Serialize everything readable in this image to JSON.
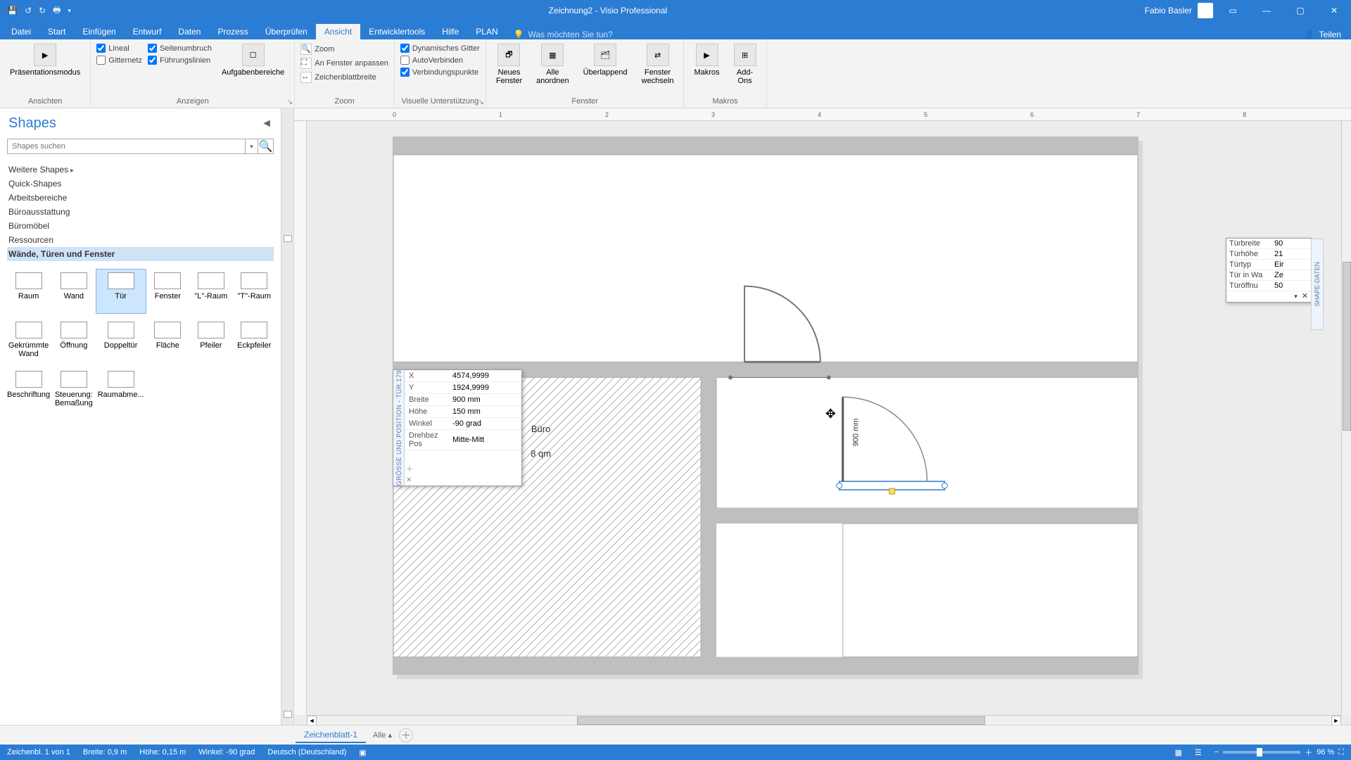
{
  "titlebar": {
    "title": "Zeichnung2 - Visio Professional",
    "user": "Fabio Basler"
  },
  "tabs": {
    "items": [
      "Datei",
      "Start",
      "Einfügen",
      "Entwurf",
      "Daten",
      "Prozess",
      "Überprüfen",
      "Ansicht",
      "Entwicklertools",
      "Hilfe",
      "PLAN"
    ],
    "active": "Ansicht",
    "tellme": "Was möchten Sie tun?",
    "share": "Teilen"
  },
  "ribbon": {
    "views": {
      "label": "Ansichten",
      "presentation": "Präsentationsmodus"
    },
    "show": {
      "label": "Anzeigen",
      "ruler": "Lineal",
      "pagebreaks": "Seitenumbruch",
      "grid": "Gitternetz",
      "guides": "Führungslinien",
      "taskpanes": "Aufgabenbereiche"
    },
    "zoom": {
      "label": "Zoom",
      "zoom": "Zoom",
      "fit": "An Fenster anpassen",
      "pagewidth": "Zeichenblattbreite"
    },
    "aids": {
      "label": "Visuelle Unterstützung",
      "dyn": "Dynamisches Gitter",
      "auto": "AutoVerbinden",
      "conn": "Verbindungspunkte"
    },
    "window": {
      "label": "Fenster",
      "new": "Neues\nFenster",
      "arrange": "Alle\nanordnen",
      "cascade": "Überlappend",
      "switch": "Fenster\nwechseln"
    },
    "macros": {
      "label": "Makros",
      "macros": "Makros",
      "addons": "Add-\nOns"
    }
  },
  "shapes": {
    "title": "Shapes",
    "search": "Shapes suchen",
    "cats": {
      "more": "Weitere Shapes",
      "quick": "Quick-Shapes",
      "c1": "Arbeitsbereiche",
      "c2": "Büroausstattung",
      "c3": "Büromöbel",
      "c4": "Ressourcen",
      "active": "Wände, Türen und Fenster"
    },
    "items": [
      "Raum",
      "Wand",
      "Tür",
      "Fenster",
      "\"L\"-Raum",
      "\"T\"-Raum",
      "Gekrümmte Wand",
      "Öffnung",
      "Doppeltür",
      "Fläche",
      "Pfeiler",
      "Eckpfeiler",
      "Beschriftung",
      "Steuerung: Bemaßung",
      "Raumabme..."
    ],
    "selected": "Tür"
  },
  "sizepos": {
    "title": "GRÖSSE UND POSITION - TÜR.179",
    "rows": [
      [
        "X",
        "4574,9999"
      ],
      [
        "Y",
        "1924,9999"
      ],
      [
        "Breite",
        "900 mm"
      ],
      [
        "Höhe",
        "150 mm"
      ],
      [
        "Winkel",
        "-90 grad"
      ],
      [
        "Drehbez Pos",
        "Mitte-Mitt"
      ]
    ]
  },
  "shapedata": {
    "title": "SHAPE-DATEN",
    "rows": [
      [
        "Türbreite",
        "90"
      ],
      [
        "Türhöhe",
        "21"
      ],
      [
        "Türtyp",
        "Eir"
      ],
      [
        "Tür in Wa",
        "Ze"
      ],
      [
        "Türöffnu",
        "50"
      ]
    ]
  },
  "drawing": {
    "room_label": "Büro",
    "room_area": "8 qm",
    "dim_label": "900 mm"
  },
  "sheets": {
    "page1": "Zeichenblatt-1",
    "all": "Alle"
  },
  "status": {
    "page": "Zeichenbl. 1 von 1",
    "w": "Breite: 0,9 m",
    "h": "Höhe: 0,15 m",
    "ang": "Winkel: -90 grad",
    "lang": "Deutsch (Deutschland)",
    "zoom": "96 %"
  },
  "ruler_marks": [
    "0",
    "1",
    "2",
    "3",
    "4",
    "5",
    "6",
    "7",
    "8"
  ]
}
